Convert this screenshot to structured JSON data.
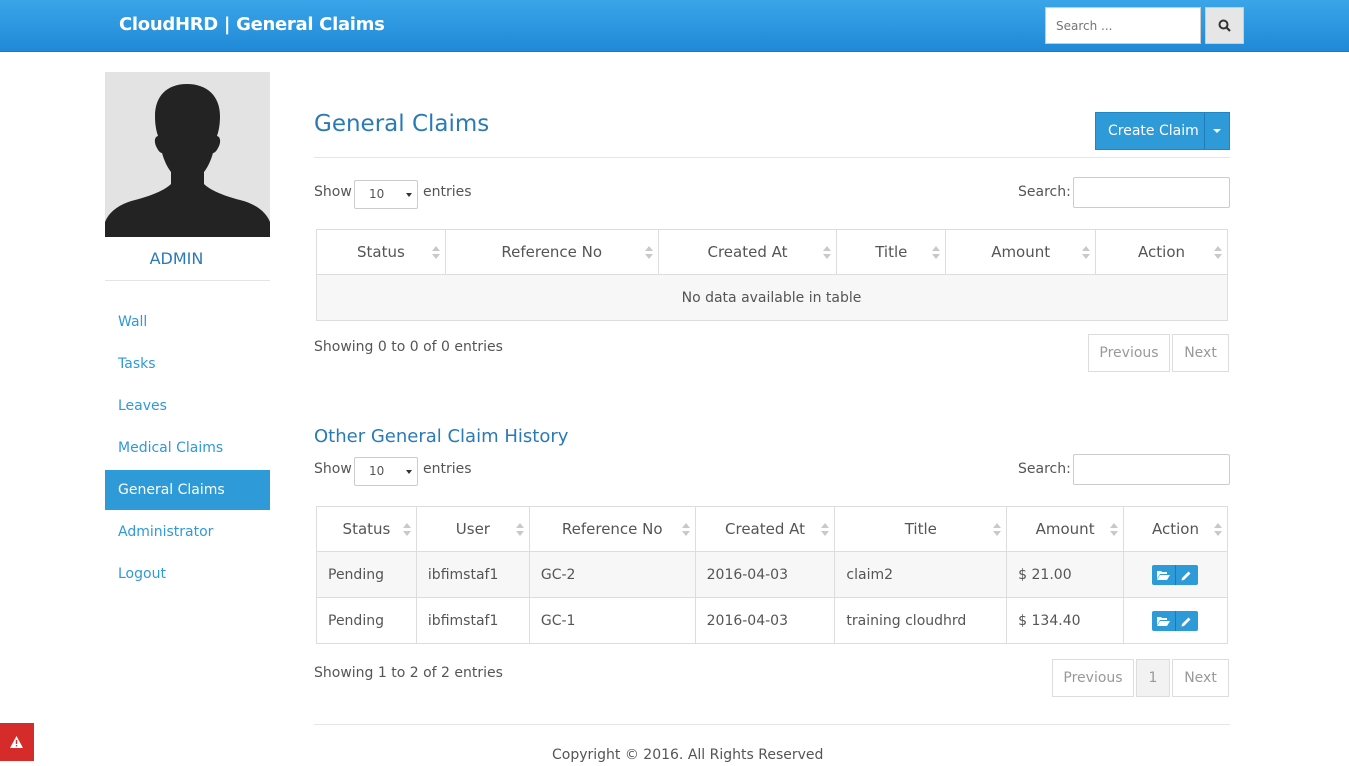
{
  "header": {
    "brand": "CloudHRD | General Claims",
    "search_placeholder": "Search ...",
    "search_icon": "search-icon"
  },
  "sidebar": {
    "username": "ADMIN",
    "items": [
      {
        "label": "Wall",
        "active": false
      },
      {
        "label": "Tasks",
        "active": false
      },
      {
        "label": "Leaves",
        "active": false
      },
      {
        "label": "Medical Claims",
        "active": false
      },
      {
        "label": "General Claims",
        "active": true
      },
      {
        "label": "Administrator",
        "active": false
      },
      {
        "label": "Logout",
        "active": false
      }
    ]
  },
  "main": {
    "title": "General Claims",
    "create_button": "Create Claim",
    "table1": {
      "show_label": "Show",
      "entries_value": "10",
      "entries_label": "entries",
      "search_label": "Search:",
      "columns": [
        "Status",
        "Reference No",
        "Created At",
        "Title",
        "Amount",
        "Action"
      ],
      "empty_text": "No data available in table",
      "info": "Showing 0 to 0 of 0 entries",
      "prev": "Previous",
      "next": "Next"
    },
    "history_title": "Other General Claim History",
    "table2": {
      "show_label": "Show",
      "entries_value": "10",
      "entries_label": "entries",
      "search_label": "Search:",
      "columns": [
        "Status",
        "User",
        "Reference No",
        "Created At",
        "Title",
        "Amount",
        "Action"
      ],
      "rows": [
        {
          "status": "Pending",
          "user": "ibfimstaf1",
          "ref": "GC-2",
          "created": "2016-04-03",
          "title": "claim2",
          "amount": "$ 21.00"
        },
        {
          "status": "Pending",
          "user": "ibfimstaf1",
          "ref": "GC-1",
          "created": "2016-04-03",
          "title": "training cloudhrd",
          "amount": "$ 134.40"
        }
      ],
      "info": "Showing 1 to 2 of 2 entries",
      "prev": "Previous",
      "page": "1",
      "next": "Next"
    }
  },
  "footer": {
    "copyright": "Copyright © 2016. All Rights Reserved"
  },
  "colors": {
    "accent": "#2e9ad8",
    "topbar": "#2a94e0",
    "alert": "#d52b2b"
  }
}
